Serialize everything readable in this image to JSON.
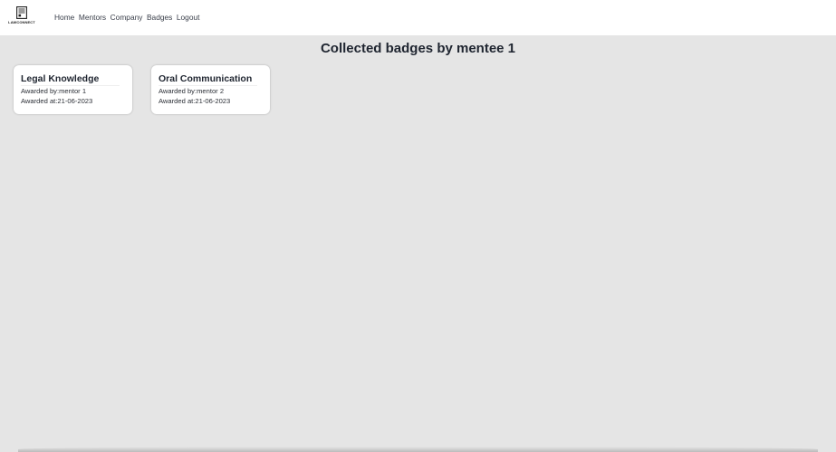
{
  "navbar": {
    "logo_text": "LAWCONNECT",
    "links": [
      "Home",
      "Mentors",
      "Company",
      "Badges",
      "Logout"
    ]
  },
  "page": {
    "title": "Collected badges by mentee 1"
  },
  "badges": [
    {
      "title": "Legal Knowledge",
      "awarded_by_label": "Awarded by:",
      "awarded_by": "mentor 1",
      "awarded_at_label": "Awarded at:",
      "awarded_at": "21-06-2023"
    },
    {
      "title": "Oral Communication",
      "awarded_by_label": "Awarded by:",
      "awarded_by": "mentor 2",
      "awarded_at_label": "Awarded at:",
      "awarded_at": "21-06-2023"
    }
  ],
  "colors": {
    "background": "#e5e5e5",
    "navbar": "#ffffff",
    "card": "#ffffff",
    "title_text": "#1f2530",
    "nav_text": "#3a3f4a"
  }
}
